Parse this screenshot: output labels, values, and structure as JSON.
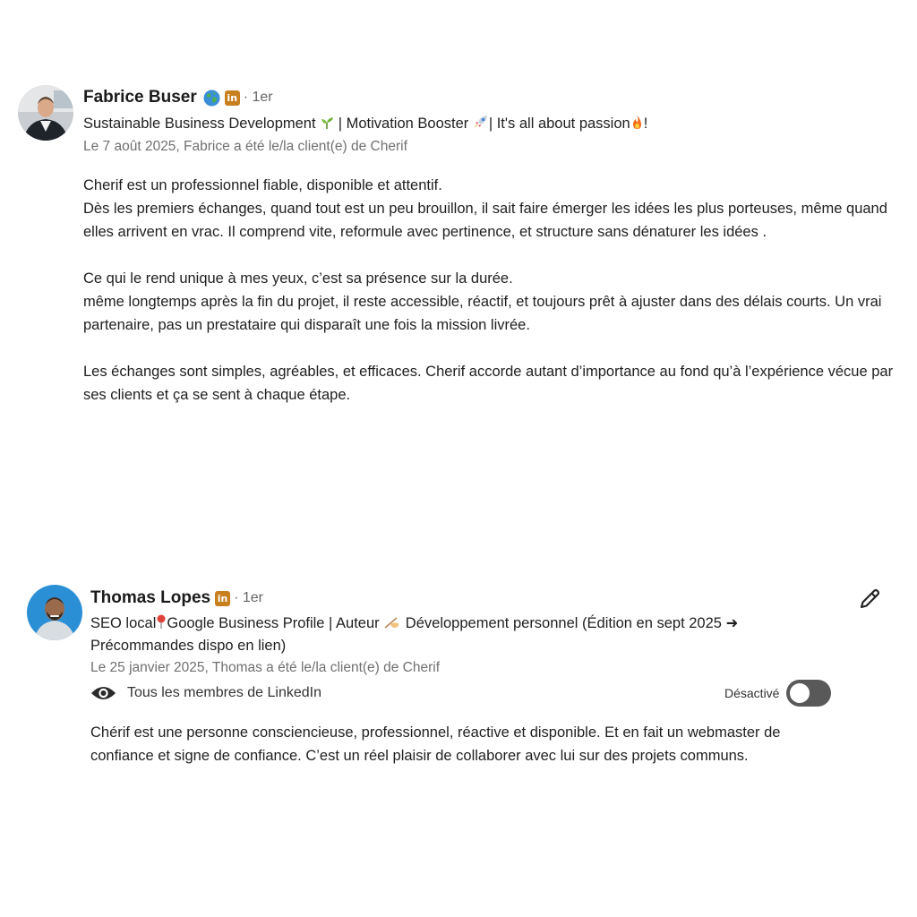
{
  "recommendations": [
    {
      "name": "Fabrice Buser",
      "degree": "· 1er",
      "headline_parts": [
        "Sustainable Business Development ",
        " | Motivation Booster ",
        "| It's all about passion",
        "!"
      ],
      "date_line": "Le 7 août 2025, Fabrice a été le/la client(e) de Cherif",
      "paragraphs": [
        "Cherif est un professionnel fiable, disponible et attentif.\nDès les premiers échanges, quand tout est un peu brouillon, il sait faire émerger les idées les plus porteuses, même quand elles arrivent en vrac. Il comprend vite, reformule avec pertinence, et structure sans dénaturer les idées .",
        "Ce qui le rend unique à mes yeux, c’est sa présence sur la durée.\nmême longtemps après la fin du projet, il reste accessible, réactif, et toujours prêt à ajuster dans des délais courts. Un vrai partenaire, pas un prestataire qui disparaît une fois la mission livrée.",
        "Les échanges sont simples, agréables, et efficaces. Cherif accorde autant d’importance au fond qu’à l’expérience vécue par ses clients et ça se sent à chaque étape."
      ]
    },
    {
      "name": "Thomas Lopes",
      "degree": "· 1er",
      "headline_parts": [
        "SEO local",
        "Google Business Profile | Auteur ",
        " Développement personnel (Édition en sept 2025 ➜ Précommandes dispo en lien)"
      ],
      "date_line": "Le 25 janvier 2025, Thomas a été le/la client(e) de Cherif",
      "visibility": "Tous les membres de LinkedIn",
      "toggle_label": "Désactivé",
      "paragraphs": [
        "Chérif est une personne consciencieuse, professionnel, réactive et disponible. Et en fait un webmaster de confiance et signe de confiance. C’est un réel plaisir de collaborer avec lui sur des projets communs."
      ]
    }
  ],
  "icons": {
    "globe": "globe-icon",
    "linkedin": "linkedin-premium-icon",
    "eye": "eye-icon",
    "edit": "pencil-icon",
    "seedling": "seedling-icon",
    "rocket": "rocket-icon",
    "fire": "fire-icon",
    "pin": "pin-icon",
    "writing": "writing-hand-icon"
  },
  "li_badge_text": "in",
  "colors": {
    "linkedin_badge": "#c8801f",
    "toggle_off": "#595959",
    "meta": "#707070"
  }
}
